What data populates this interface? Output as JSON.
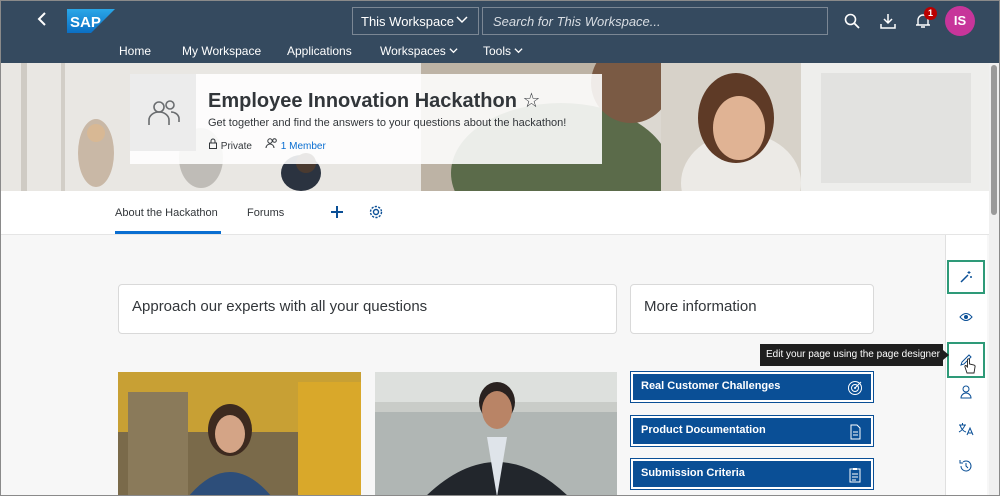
{
  "header": {
    "workspace_select": "This Workspace",
    "search_placeholder": "Search for This Workspace...",
    "notification_count": "1",
    "avatar_initials": "IS"
  },
  "nav": {
    "items": [
      "Home",
      "My Workspace",
      "Applications",
      "Workspaces",
      "Tools"
    ]
  },
  "hero": {
    "title": "Employee Innovation Hackathon",
    "star": "☆",
    "description": "Get together and find the answers to your questions about the hackathon!",
    "privacy": "Private",
    "members": "1 Member"
  },
  "tabs": {
    "items": [
      "About the Hackathon",
      "Forums"
    ],
    "active": "About the Hackathon"
  },
  "content": {
    "card_experts": "Approach our experts with all your questions",
    "card_more_info": "More information",
    "links": [
      "Real Customer Challenges",
      "Product Documentation",
      "Submission Criteria"
    ]
  },
  "tooltip": "Edit your page using the page designer",
  "colors": {
    "shell": "#354a5f",
    "accent": "#0a6ed1",
    "link_tile": "#0a4f96",
    "highlight": "#2e9a78",
    "avatar": "#c7359a"
  }
}
